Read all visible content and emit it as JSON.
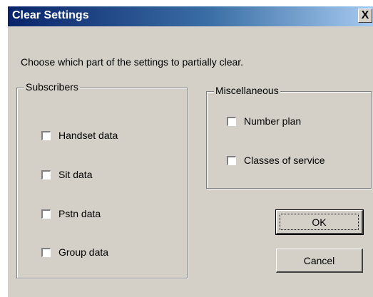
{
  "dialog": {
    "title": "Clear Settings",
    "close_label": "X",
    "instruction": "Choose which part of the settings to partially clear."
  },
  "subscribers": {
    "legend": "Subscribers",
    "items": [
      {
        "label": "Handset data",
        "checked": false
      },
      {
        "label": "Sit data",
        "checked": false
      },
      {
        "label": "Pstn data",
        "checked": false
      },
      {
        "label": "Group data",
        "checked": false
      }
    ]
  },
  "miscellaneous": {
    "legend": "Miscellaneous",
    "items": [
      {
        "label": "Number plan",
        "checked": false
      },
      {
        "label": "Classes of service",
        "checked": false
      }
    ]
  },
  "buttons": {
    "ok_label": "OK",
    "cancel_label": "Cancel"
  },
  "colors": {
    "face": "#d4d0c8",
    "title_start": "#0a246a",
    "title_end": "#a6caf0"
  }
}
